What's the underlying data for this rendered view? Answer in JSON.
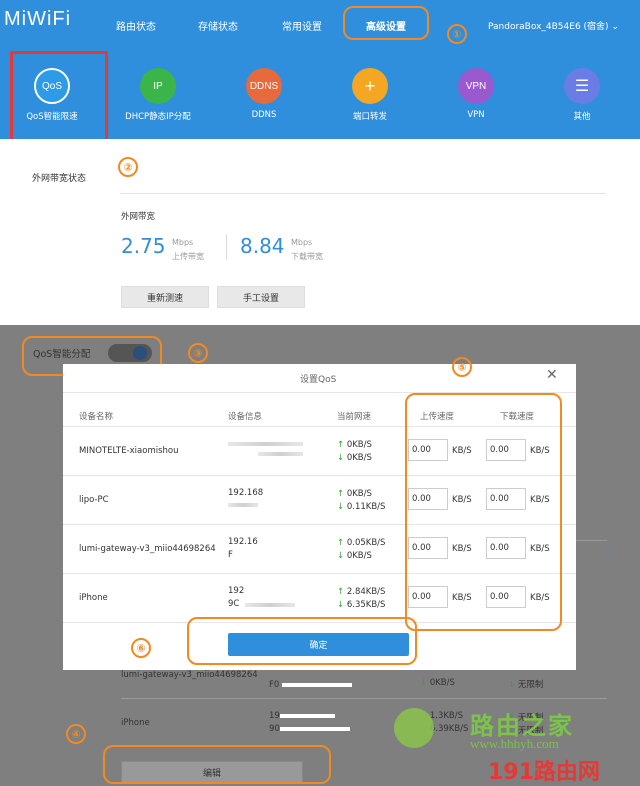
{
  "header": {
    "logo": "MiWiFi",
    "nav": [
      "路由状态",
      "存储状态",
      "常用设置",
      "高级设置"
    ],
    "router_name": "PandoraBox_4B54E6 (宿舍)",
    "chevron": "chevron-down-icon"
  },
  "categories": [
    {
      "icon": "QoS",
      "label": "QoS智能限速",
      "color": "#2d9be6"
    },
    {
      "icon": "IP",
      "label": "DHCP静态IP分配",
      "color": "#3bb54a"
    },
    {
      "icon": "DDNS",
      "label": "DDNS",
      "color": "#e66a3c"
    },
    {
      "icon": "plus-icon",
      "label": "端口转发",
      "color": "#f5a623"
    },
    {
      "icon": "VPN",
      "label": "VPN",
      "color": "#9b59d0"
    },
    {
      "icon": "menu-icon",
      "label": "其他",
      "color": "#6a7de6"
    }
  ],
  "bandwidth": {
    "tab": "外网带宽状态",
    "section_title": "外网带宽",
    "upload_value": "2.75",
    "upload_unit": "Mbps",
    "upload_label": "上传带宽",
    "download_value": "8.84",
    "download_unit": "Mbps",
    "download_label": "下载带宽",
    "retest_button": "重新测速",
    "manual_button": "手工设置"
  },
  "qos_toggle": {
    "label": "QoS智能分配",
    "on": true
  },
  "modal": {
    "title": "设置QoS",
    "close": "close-icon",
    "columns": [
      "设备名称",
      "设备信息",
      "当前网速",
      "上传速度",
      "下载速度"
    ],
    "unit": "KB/S",
    "rows": [
      {
        "name": "MINOTELTE-xiaomishou",
        "info1": "",
        "info2": "",
        "up": "0KB/S",
        "down": "0KB/S",
        "up_limit": "0.00",
        "down_limit": "0.00"
      },
      {
        "name": "lipo-PC",
        "info1": "192.168",
        "info2": "",
        "up": "0KB/S",
        "down": "0.11KB/S",
        "up_limit": "0.00",
        "down_limit": "0.00"
      },
      {
        "name": "lumi-gateway-v3_miio44698264",
        "info1": "192.16",
        "info2": "F",
        "up": "0.05KB/S",
        "down": "0KB/S",
        "up_limit": "0.00",
        "down_limit": "0.00"
      },
      {
        "name": "iPhone",
        "info1": "192",
        "info2": "9C",
        "up": "2.84KB/S",
        "down": "6.35KB/S",
        "up_limit": "0.00",
        "down_limit": "0.00"
      }
    ],
    "confirm_button": "确定"
  },
  "background_table": {
    "rows": [
      {
        "name": "lumi-gateway-v3_miio44698264",
        "info": "F0",
        "down": "0KB/S",
        "limit": "无限制"
      },
      {
        "name": "iPhone",
        "info1": "19",
        "info2": "90",
        "up": "1.3KB/S",
        "down": "6.39KB/S",
        "limit": "无限制",
        "limit2": "无限制"
      }
    ],
    "edit_button": "编辑"
  },
  "annotations": [
    "①",
    "②",
    "③",
    "④",
    "⑤",
    "⑥"
  ],
  "watermark": {
    "text1": "路由之家",
    "text2": "www.hhhyh.com",
    "text3": "191路由网"
  }
}
